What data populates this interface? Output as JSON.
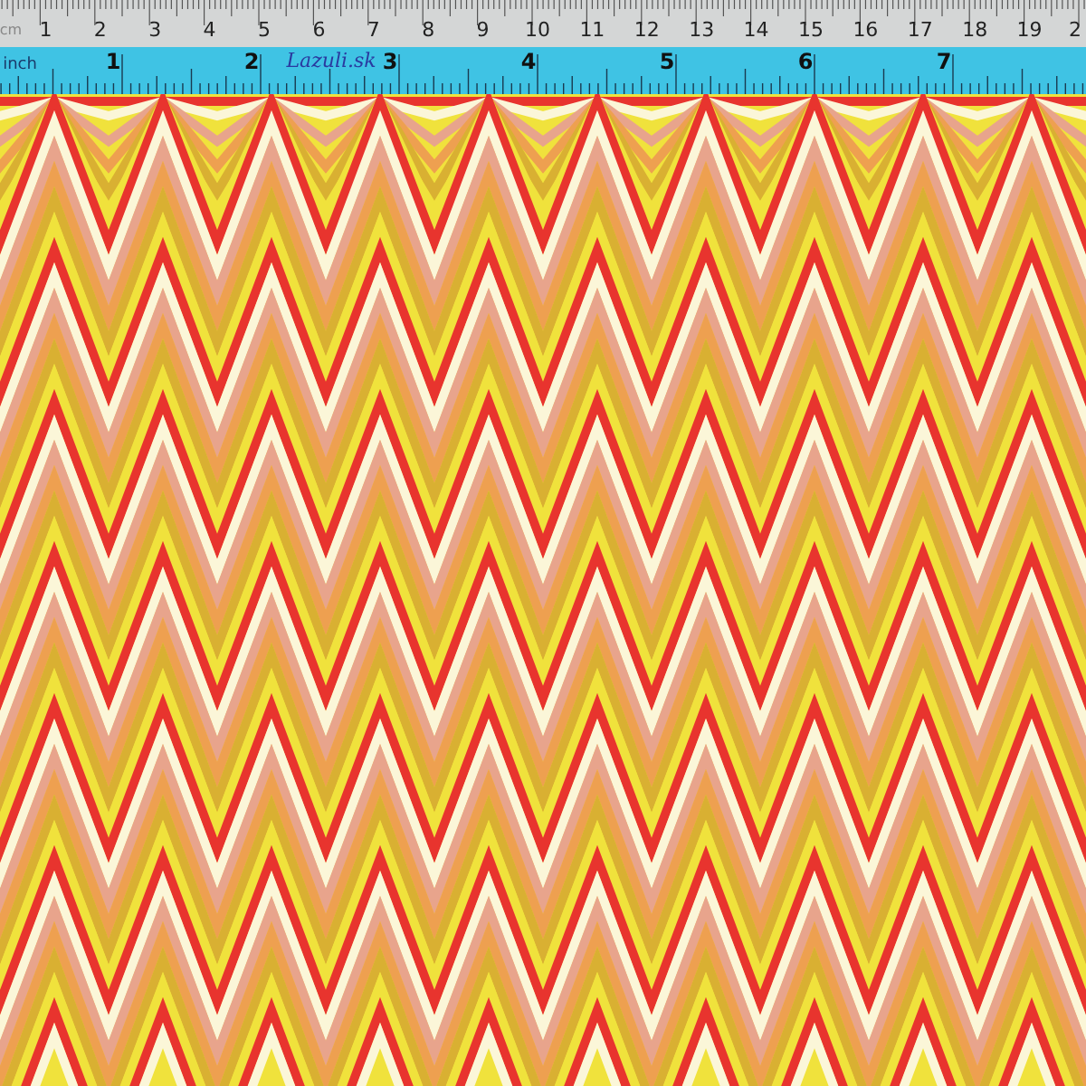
{
  "ruler": {
    "cm_scale": {
      "unit": "cm",
      "labels": [
        "1",
        "2",
        "3",
        "4",
        "5",
        "6",
        "7",
        "8",
        "9",
        "10",
        "11",
        "12",
        "13",
        "14",
        "15",
        "16",
        "17",
        "18",
        "19",
        "2"
      ]
    },
    "inch_scale": {
      "unit": "inch",
      "labels": [
        "1",
        "2",
        "3",
        "4",
        "5",
        "6",
        "7"
      ]
    },
    "handwritten_note": "Lazuli.sk"
  }
}
